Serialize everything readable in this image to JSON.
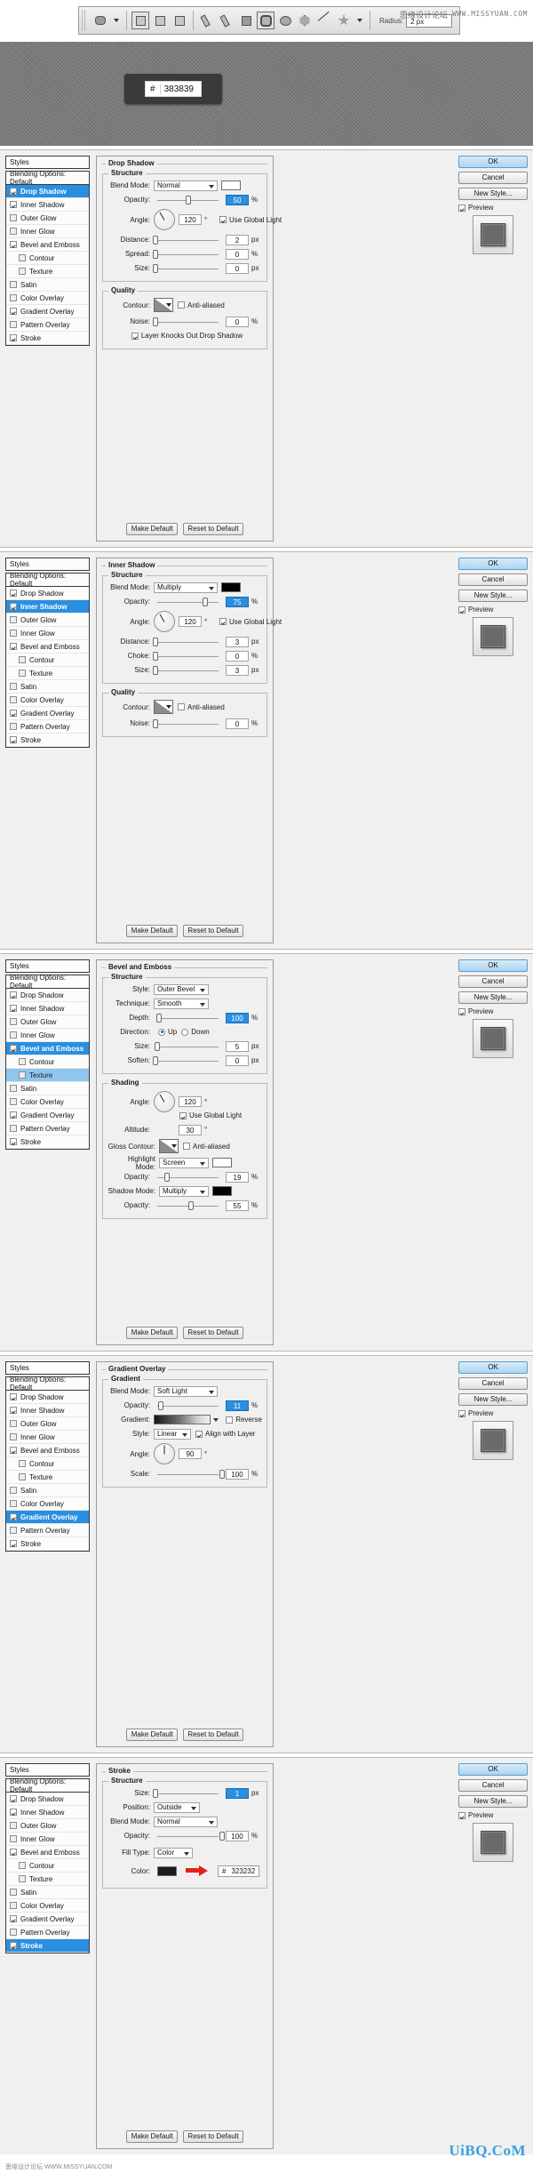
{
  "toolbar": {
    "shape_tool": "rounded-rectangle-tool",
    "radius_label": "Radius:",
    "radius_value": "2 px",
    "watermark_cn": "思缘设计论坛",
    "watermark_url": "WWW.MISSYUAN.COM"
  },
  "canvas": {
    "hex_prefix": "#",
    "hex_value": "383839"
  },
  "styles_panel": {
    "header": "Styles",
    "blending_options": "Blending Options: Default",
    "items": [
      {
        "label": "Drop Shadow",
        "checked": true
      },
      {
        "label": "Inner Shadow",
        "checked": true
      },
      {
        "label": "Outer Glow",
        "checked": false
      },
      {
        "label": "Inner Glow",
        "checked": false
      },
      {
        "label": "Bevel and Emboss",
        "checked": true
      },
      {
        "label": "Contour",
        "checked": false,
        "sub": true
      },
      {
        "label": "Texture",
        "checked": false,
        "sub": true
      },
      {
        "label": "Satin",
        "checked": false
      },
      {
        "label": "Color Overlay",
        "checked": false
      },
      {
        "label": "Gradient Overlay",
        "checked": true
      },
      {
        "label": "Pattern Overlay",
        "checked": false
      },
      {
        "label": "Stroke",
        "checked": true
      }
    ]
  },
  "buttons": {
    "ok": "OK",
    "cancel": "Cancel",
    "new_style": "New Style...",
    "preview": "Preview",
    "make_default": "Make Default",
    "reset_to_default": "Reset to Default"
  },
  "labels": {
    "structure": "Structure",
    "quality": "Quality",
    "shading": "Shading",
    "gradient": "Gradient:",
    "blend_mode": "Blend Mode:",
    "opacity": "Opacity:",
    "angle": "Angle:",
    "distance": "Distance:",
    "spread": "Spread:",
    "size": "Size:",
    "choke": "Choke:",
    "contour": "Contour:",
    "noise": "Noise:",
    "use_global_light": "Use Global Light",
    "anti_aliased": "Anti-aliased",
    "layer_knocks_out": "Layer Knocks Out Drop Shadow",
    "style": "Style:",
    "technique": "Technique:",
    "depth": "Depth:",
    "direction": "Direction:",
    "soften": "Soften:",
    "altitude": "Altitude:",
    "gloss_contour": "Gloss Contour:",
    "highlight_mode": "Highlight Mode:",
    "shadow_mode": "Shadow Mode:",
    "up": "Up",
    "down": "Down",
    "reverse": "Reverse",
    "align_with_layer": "Align with Layer",
    "scale": "Scale:",
    "position": "Position:",
    "fill_type": "Fill Type:",
    "color": "Color:"
  },
  "units": {
    "px": "px",
    "pct": "%",
    "deg": "°"
  },
  "panels": [
    {
      "id": "drop-shadow",
      "title": "Drop Shadow",
      "selected_style": "Drop Shadow",
      "blend_mode": "Normal",
      "blend_color": "#ffffff",
      "opacity": "50",
      "angle": "120",
      "use_global_light": true,
      "distance": "2",
      "spread": "0",
      "size": "0",
      "anti_aliased": false,
      "noise": "0",
      "layer_knocks_out": true
    },
    {
      "id": "inner-shadow",
      "title": "Inner Shadow",
      "selected_style": "Inner Shadow",
      "blend_mode": "Multiply",
      "blend_color": "#000000",
      "opacity": "75",
      "angle": "120",
      "use_global_light": true,
      "distance": "3",
      "choke": "0",
      "size": "3",
      "anti_aliased": false,
      "noise": "0"
    },
    {
      "id": "bevel-and-emboss",
      "title": "Bevel and Emboss",
      "selected_style": "Bevel and Emboss",
      "style": "Outer Bevel",
      "technique": "Smooth",
      "depth": "100",
      "direction": "Up",
      "size": "5",
      "soften": "0",
      "angle": "120",
      "use_global_light": true,
      "altitude": "30",
      "anti_aliased": false,
      "highlight_mode": "Screen",
      "highlight_color": "#ffffff",
      "highlight_opacity": "19",
      "shadow_mode": "Multiply",
      "shadow_color": "#000000",
      "shadow_opacity": "55"
    },
    {
      "id": "gradient-overlay",
      "title": "Gradient Overlay",
      "selected_style": "Gradient Overlay",
      "blend_mode": "Soft Light",
      "opacity": "11",
      "reverse": false,
      "gradient_style": "Linear",
      "align_with_layer": true,
      "angle": "90",
      "scale": "100"
    },
    {
      "id": "stroke",
      "title": "Stroke",
      "selected_style": "Stroke",
      "size": "1",
      "position": "Outside",
      "blend_mode": "Normal",
      "opacity": "100",
      "fill_type": "Color",
      "color_swatch": "#1c1c1c",
      "color_hex_prefix": "#",
      "color_hex": "323232"
    }
  ],
  "footer": {
    "brand": "UiBQ.CoM",
    "watermark_cn": "思缘设计论坛",
    "watermark_url": "WWW.MISSYUAN.COM"
  }
}
